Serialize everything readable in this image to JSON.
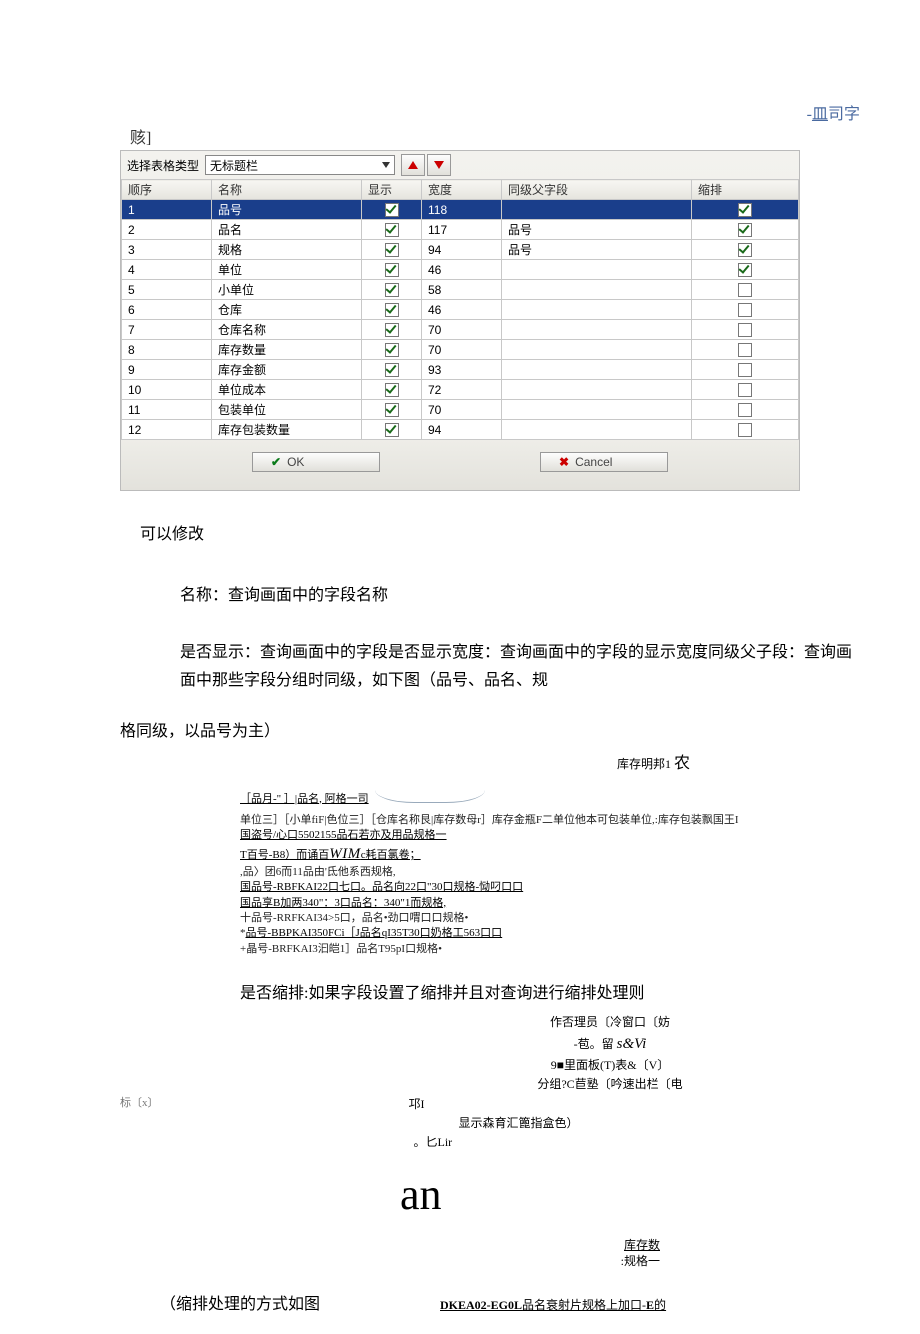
{
  "header": {
    "top_label": "-皿司字",
    "left_label": "赅]"
  },
  "dialog": {
    "label": "选择表格类型",
    "dropdown_value": "无标题栏",
    "columns": [
      "顺序",
      "名称",
      "显示",
      "宽度",
      "同级父字段",
      "缩排"
    ],
    "rows": [
      {
        "seq": "1",
        "name": "品号",
        "show": true,
        "width": "118",
        "parent": "",
        "indent": true
      },
      {
        "seq": "2",
        "name": "品名",
        "show": true,
        "width": "117",
        "parent": "品号",
        "indent": true
      },
      {
        "seq": "3",
        "name": "规格",
        "show": true,
        "width": "94",
        "parent": "品号",
        "indent": true
      },
      {
        "seq": "4",
        "name": "单位",
        "show": true,
        "width": "46",
        "parent": "",
        "indent": true
      },
      {
        "seq": "5",
        "name": "小单位",
        "show": true,
        "width": "58",
        "parent": "",
        "indent": false
      },
      {
        "seq": "6",
        "name": "仓库",
        "show": true,
        "width": "46",
        "parent": "",
        "indent": false
      },
      {
        "seq": "7",
        "name": "仓库名称",
        "show": true,
        "width": "70",
        "parent": "",
        "indent": false
      },
      {
        "seq": "8",
        "name": "库存数量",
        "show": true,
        "width": "70",
        "parent": "",
        "indent": false
      },
      {
        "seq": "9",
        "name": "库存金额",
        "show": true,
        "width": "93",
        "parent": "",
        "indent": false
      },
      {
        "seq": "10",
        "name": "单位成本",
        "show": true,
        "width": "72",
        "parent": "",
        "indent": false
      },
      {
        "seq": "11",
        "name": "包装单位",
        "show": true,
        "width": "70",
        "parent": "",
        "indent": false
      },
      {
        "seq": "12",
        "name": "库存包装数量",
        "show": true,
        "width": "94",
        "parent": "",
        "indent": false
      }
    ],
    "ok_label": "OK",
    "cancel_label": "Cancel"
  },
  "body": {
    "can_modify": "可以修改",
    "name_line": "名称：查询画面中的字段名称",
    "show_line": "是否显示：查询画面中的字段是否显示宽度：查询画面中的字段的显示宽度同级父子段：查询画面中那些字段分组时同级，如下图（品号、品名、规",
    "group_note": "格同级，以品号为主）",
    "small_right": "库存明邦1",
    "small_right_big": "农",
    "ex_title": "［品月-\" ］|品名, 阿格一司",
    "ex_lines": [
      "单位三］［小单fiF|色位三］［仓库名称艮|库存数母r］库存金瓶F二单位他本可包装单位,:库存包装飘国王I",
      "国盗号/心口5502155品石若亦及用品规格一",
      "T百号-B8）而诵百WIMc耗百氯卷；",
      ",品〉团6而11品由'氐他系西规格,",
      "国品号-RBFKAI22口七口。品名向22口\"30口规格-恸叼口口",
      "国品享B加两340\"：3口品名：340\"1而规格,",
      "十品号-RRFKAI34>5口，品名•劲口喟口口规格•",
      "*品号-BBPKAI350FCi［J品名qI35T30口奶格工563口口",
      "+晶号-BRFKAI3汩皑1］品名T95pI口规格•"
    ],
    "indent_heading": "是否缩排:如果字段设置了缩排并且对查询进行缩排处理则",
    "misc1": "作否理员〔冷窗口〔妨",
    "misc2a": "-苞。留",
    "misc2b": "s&Vi",
    "misc3a": "9■里面板(T)表&〔V〕",
    "misc3b": "分组?C苣塾〔吟速出栏〔电",
    "left_tiny": "标〔x〕",
    "misc4a": "邛I",
    "misc4b": "显示森育汇篦指盒色）",
    "misc5": "。匕Lir",
    "an": "an",
    "r1": "库存数",
    "r2": ":规格一",
    "bottom_left": "（缩排处理的方式如图",
    "bottom_mid_a": "DKEA02-EG0L",
    "bottom_mid_b": "品名衰射片规格上加口-",
    "bottom_mid_c": "E",
    "bottom_mid_d": "的"
  }
}
